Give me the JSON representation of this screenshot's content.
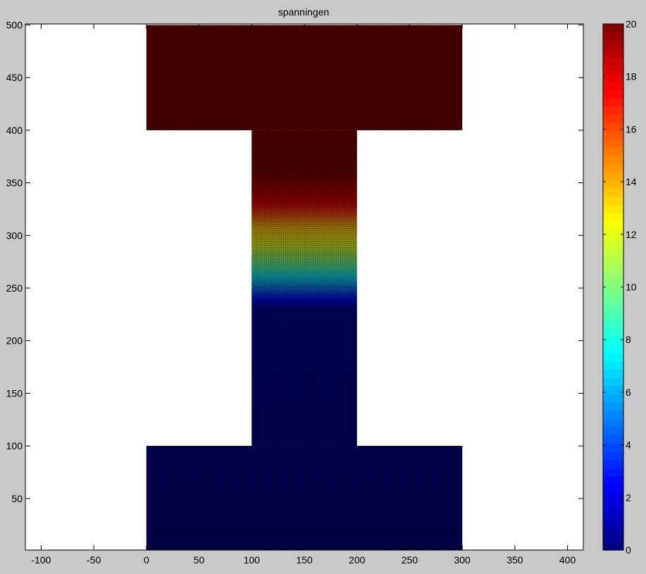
{
  "chart_data": {
    "type": "heatmap",
    "title": "spanningen",
    "xlabel": "",
    "ylabel": "",
    "xlim": [
      -115,
      415
    ],
    "ylim": [
      1,
      501
    ],
    "xticks": [
      -100,
      -50,
      0,
      50,
      100,
      150,
      200,
      250,
      300,
      350,
      400
    ],
    "yticks": [
      50,
      100,
      150,
      200,
      250,
      300,
      350,
      400,
      450,
      500
    ],
    "xtick_labels": [
      "-100",
      "-50",
      "0",
      "50",
      "100",
      "150",
      "200",
      "250",
      "300",
      "350",
      "400"
    ],
    "ytick_labels": [
      "50",
      "100",
      "150",
      "200",
      "250",
      "300",
      "350",
      "400",
      "450",
      "500"
    ],
    "cross_section": {
      "shape": "I-beam",
      "regions": [
        {
          "part": "bottom flange",
          "x": [
            0,
            300
          ],
          "y": [
            0,
            100
          ]
        },
        {
          "part": "web",
          "x": [
            100,
            200
          ],
          "y": [
            100,
            400
          ]
        },
        {
          "part": "top flange",
          "x": [
            0,
            300
          ],
          "y": [
            400,
            500
          ]
        }
      ]
    },
    "value_profile": [
      {
        "y": 0,
        "value": 0
      },
      {
        "y": 230,
        "value": 0.5
      },
      {
        "y": 250,
        "value": 5
      },
      {
        "y": 270,
        "value": 9
      },
      {
        "y": 290,
        "value": 12
      },
      {
        "y": 310,
        "value": 14
      },
      {
        "y": 330,
        "value": 18
      },
      {
        "y": 360,
        "value": 20
      },
      {
        "y": 500,
        "value": 20
      }
    ],
    "colorbar": {
      "colormap": "jet",
      "range": [
        0,
        20
      ],
      "ticks": [
        0,
        2,
        4,
        6,
        8,
        10,
        12,
        14,
        16,
        18,
        20
      ],
      "tick_labels": [
        "0",
        "2",
        "4",
        "6",
        "8",
        "10",
        "12",
        "14",
        "16",
        "18",
        "20"
      ],
      "levels": 64
    },
    "mesh_grid": true
  }
}
